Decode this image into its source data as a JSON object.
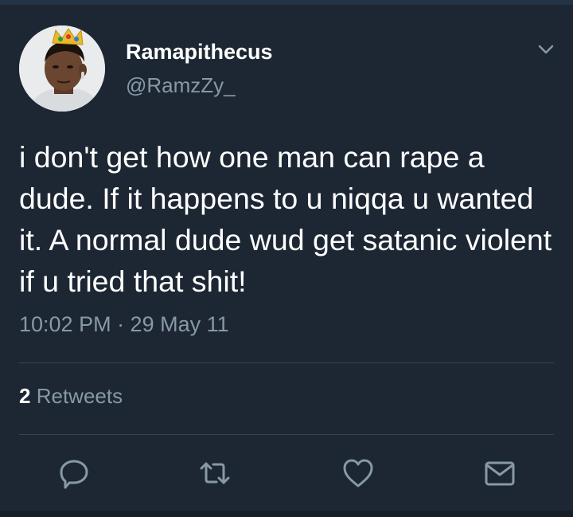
{
  "tweet": {
    "author": {
      "display_name": "Ramapithecus",
      "handle": "@RamzZy_"
    },
    "text": "i don't get how one man can rape a dude. If it happens to u niqqa u wanted it. A normal dude wud get satanic violent if u tried that shit!",
    "timestamp": "10:02 PM · 29 May 11",
    "stats": {
      "retweet_count": "2",
      "retweet_label": "Retweets"
    }
  },
  "icons": {
    "menu": "chevron-down-icon",
    "reply": "reply-icon",
    "retweet": "retweet-icon",
    "like": "heart-icon",
    "message": "envelope-icon"
  },
  "colors": {
    "background": "#1c2733",
    "primary_text": "#ffffff",
    "secondary_text": "#8899a6",
    "divider": "#38444d",
    "icon": "#8899a6"
  }
}
